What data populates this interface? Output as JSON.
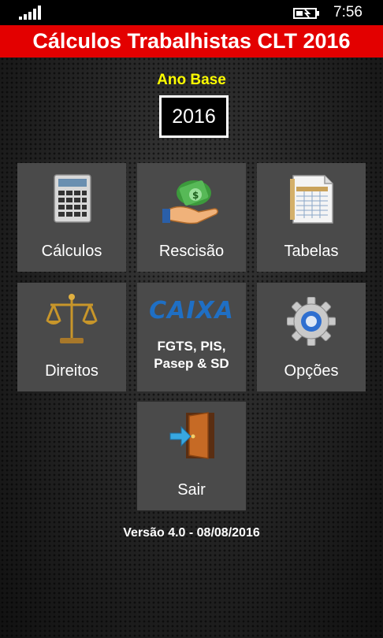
{
  "status_bar": {
    "time": "7:56"
  },
  "header": {
    "title": "Cálculos Trabalhistas CLT 2016"
  },
  "year": {
    "label": "Ano Base",
    "value": "2016"
  },
  "tiles": {
    "calculos": {
      "label": "Cálculos",
      "icon": "calculator-icon"
    },
    "rescisao": {
      "label": "Rescisão",
      "icon": "money-hand-icon"
    },
    "tabelas": {
      "label": "Tabelas",
      "icon": "spreadsheet-icon"
    },
    "direitos": {
      "label": "Direitos",
      "icon": "scales-icon"
    },
    "fgts": {
      "logo": "CAIXA",
      "label_line1": "FGTS, PIS,",
      "label_line2": "Pasep & SD",
      "icon": "caixa-logo-icon"
    },
    "opcoes": {
      "label": "Opções",
      "icon": "gear-icon"
    },
    "sair": {
      "label": "Sair",
      "icon": "exit-door-icon"
    }
  },
  "footer": {
    "version": "Versão 4.0 - 08/08/2016"
  },
  "colors": {
    "title_bar": "#e30000",
    "year_label": "#ffff00",
    "tile": "#4a4a4a",
    "caixa_blue": "#1f6fc4"
  }
}
